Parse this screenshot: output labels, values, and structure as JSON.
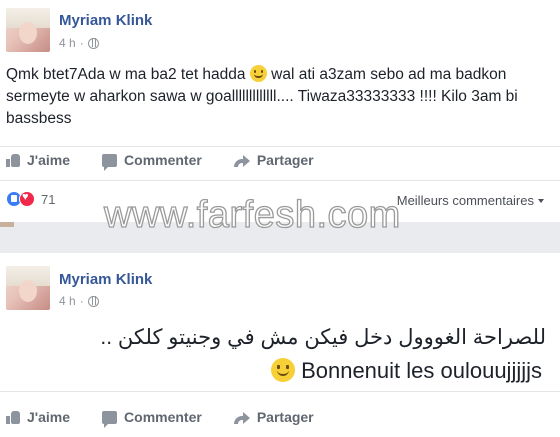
{
  "watermark": "www.farfesh.com",
  "post1": {
    "author": "Myriam Klink",
    "time": "4 h",
    "text": "Qmk btet7Ada w ma ba2 tet hadda",
    "text_after_emoji": "wal ati a3zam sebo ad ma badkon sermeyte w aharkon sawa w goalllllllllllll.... Tiwaza33333333 !!!! Kilo 3am bi bassbess",
    "actions": {
      "like": "J'aime",
      "comment": "Commenter",
      "share": "Partager"
    },
    "reaction_count": "71",
    "best_comments": "Meilleurs commentaires"
  },
  "post2": {
    "author": "Myriam Klink",
    "time": "4 h",
    "arabic_text": "للصراحة الغووول دخل فيكن مش في وجنيتو كلكن ..",
    "text": "Bonnenuit les oulouujjjjjs",
    "actions": {
      "like": "J'aime",
      "comment": "Commenter",
      "share": "Partager"
    }
  }
}
